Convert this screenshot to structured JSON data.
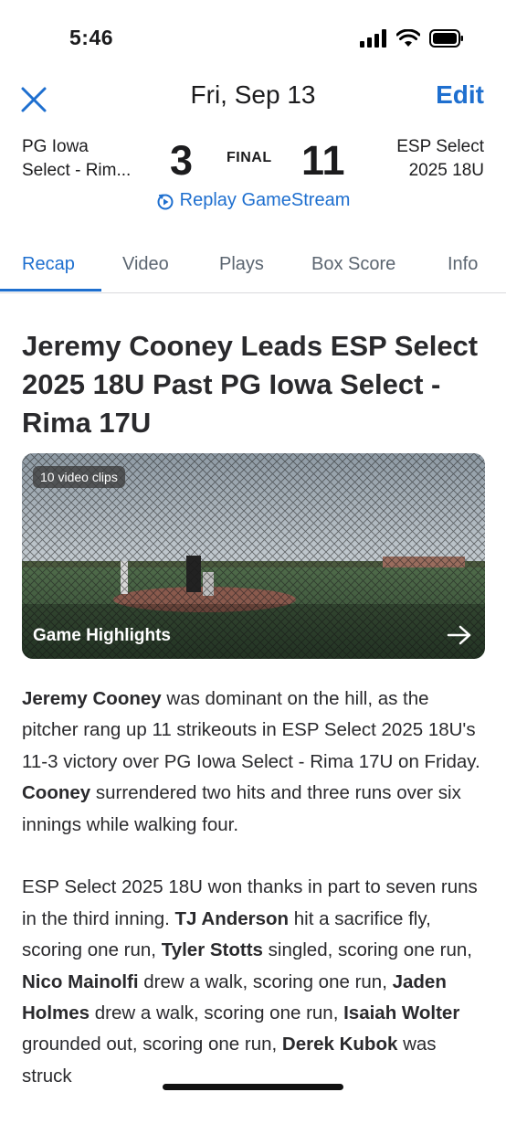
{
  "status": {
    "time": "5:46"
  },
  "nav": {
    "title": "Fri, Sep 13",
    "edit_label": "Edit"
  },
  "game": {
    "team_left_line1": "PG Iowa",
    "team_left_line2": "Select - Rim...",
    "score_left": "3",
    "status": "FINAL",
    "score_right": "11",
    "team_right_line1": "ESP Select",
    "team_right_line2": "2025 18U"
  },
  "replay_label": "Replay GameStream",
  "tabs": [
    {
      "label": "Recap"
    },
    {
      "label": "Video"
    },
    {
      "label": "Plays"
    },
    {
      "label": "Box Score"
    },
    {
      "label": "Info"
    }
  ],
  "active_tab": "Recap",
  "article": {
    "headline": "Jeremy Cooney Leads ESP Select 2025 18U Past PG Iowa Select - Rima 17U",
    "video": {
      "clips_badge": "10 video clips",
      "label": "Game Highlights"
    },
    "p1": {
      "b1": "Jeremy Cooney",
      "t1": " was dominant on the hill, as the pitcher rang up 11 strikeouts in ESP Select 2025 18U's 11-3 victory over PG Iowa Select - Rima 17U on Friday. ",
      "b2": "Cooney",
      "t2": " surrendered two hits and three runs over six innings while walking four."
    },
    "p2": {
      "t0": "ESP Select 2025 18U won thanks in part to seven runs in the third inning.  ",
      "b1": "TJ Anderson",
      "t1": " hit a sacrifice fly, scoring one run, ",
      "b2": "Tyler Stotts",
      "t2": " singled, scoring one run, ",
      "b3": "Nico Mainolfi",
      "t3": " drew a walk, scoring one run, ",
      "b4": "Jaden Holmes",
      "t4": " drew a walk, scoring one run, ",
      "b5": "Isaiah Wolter",
      "t5": " grounded out, scoring one run, ",
      "b6": "Derek Kubok",
      "t6": " was struck"
    }
  },
  "colors": {
    "accent": "#1e6fcf",
    "text": "#2a2a2d",
    "secondary": "#5b6570"
  }
}
